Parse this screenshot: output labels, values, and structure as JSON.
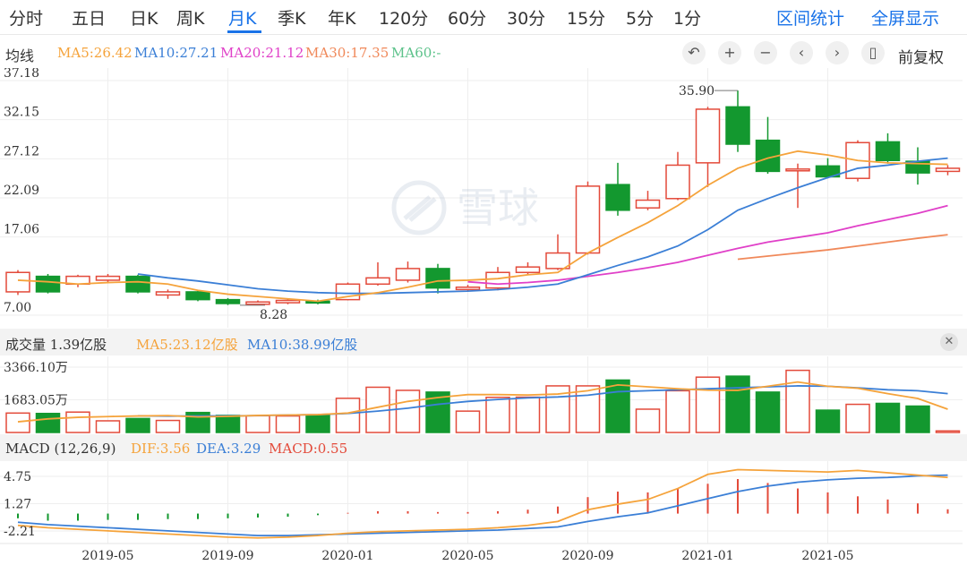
{
  "tabs": {
    "items": [
      "分时",
      "五日",
      "日K",
      "周K",
      "月K",
      "季K",
      "年K",
      "120分",
      "60分",
      "30分",
      "15分",
      "5分",
      "1分"
    ],
    "active": "月K",
    "right_items": [
      "区间统计",
      "全屏显示"
    ]
  },
  "ma_row": {
    "title": "均线",
    "items": [
      {
        "label": "MA5:26.42",
        "color": "#f5a33b"
      },
      {
        "label": "MA10:27.21",
        "color": "#3b7fd6"
      },
      {
        "label": "MA20:21.12",
        "color": "#e040c8"
      },
      {
        "label": "MA30:17.35",
        "color": "#f0895a"
      },
      {
        "label": "MA60:-",
        "color": "#5cc28a"
      }
    ],
    "controls": [
      "↶",
      "+",
      "−",
      "‹",
      "›",
      "▯"
    ],
    "restore_label": "前复权"
  },
  "volume_row": {
    "title": "成交量 1.39亿股",
    "ma5": "MA5:23.12亿股",
    "ma10": "MA10:38.99亿股"
  },
  "macd_row": {
    "title": "MACD (12,26,9)",
    "dif": "DIF:3.56",
    "dea": "DEA:3.29",
    "macd": "MACD:0.55"
  },
  "watermark": "雪球",
  "colors": {
    "up": "#e34a3a",
    "down": "#13982f",
    "ma5": "#f5a33b",
    "ma10": "#3b7fd6",
    "ma20": "#e040c8",
    "ma30": "#f0895a",
    "grid": "#eeeeee"
  },
  "chart_data": [
    {
      "type": "candlestick",
      "price_axis_labels": [
        "37.18",
        "32.15",
        "27.12",
        "22.09",
        "17.06",
        "7.00"
      ],
      "ylim": [
        7.0,
        37.18
      ],
      "high_annotation": "35.90",
      "low_annotation": "8.28",
      "x_tick_labels": [
        "2019-05",
        "2019-09",
        "2020-01",
        "2020-05",
        "2020-09",
        "2021-01",
        "2021-05"
      ],
      "candles": [
        {
          "o": 10.0,
          "c": 12.5,
          "h": 12.8,
          "l": 9.6
        },
        {
          "o": 12.0,
          "c": 10.0,
          "h": 12.3,
          "l": 9.8
        },
        {
          "o": 11.0,
          "c": 12.0,
          "h": 12.2,
          "l": 10.6
        },
        {
          "o": 11.5,
          "c": 12.0,
          "h": 12.3,
          "l": 11.2
        },
        {
          "o": 12.0,
          "c": 10.0,
          "h": 12.2,
          "l": 9.8
        },
        {
          "o": 9.6,
          "c": 10.0,
          "h": 10.3,
          "l": 9.1
        },
        {
          "o": 10.0,
          "c": 9.0,
          "h": 10.2,
          "l": 8.8
        },
        {
          "o": 9.0,
          "c": 8.5,
          "h": 9.2,
          "l": 8.3
        },
        {
          "o": 8.4,
          "c": 8.7,
          "h": 8.9,
          "l": 8.28
        },
        {
          "o": 8.6,
          "c": 8.9,
          "h": 9.1,
          "l": 8.4
        },
        {
          "o": 8.8,
          "c": 8.6,
          "h": 9.0,
          "l": 8.4
        },
        {
          "o": 9.0,
          "c": 11.0,
          "h": 11.2,
          "l": 8.9
        },
        {
          "o": 11.0,
          "c": 11.8,
          "h": 13.8,
          "l": 10.8
        },
        {
          "o": 11.5,
          "c": 13.0,
          "h": 13.9,
          "l": 11.2
        },
        {
          "o": 13.0,
          "c": 10.5,
          "h": 13.6,
          "l": 9.8
        },
        {
          "o": 10.3,
          "c": 10.6,
          "h": 10.9,
          "l": 10.0
        },
        {
          "o": 10.5,
          "c": 12.5,
          "h": 13.2,
          "l": 10.2
        },
        {
          "o": 12.5,
          "c": 13.2,
          "h": 13.8,
          "l": 12.2
        },
        {
          "o": 13.0,
          "c": 15.0,
          "h": 17.4,
          "l": 12.8
        },
        {
          "o": 15.0,
          "c": 23.6,
          "h": 24.2,
          "l": 14.8
        },
        {
          "o": 23.8,
          "c": 20.5,
          "h": 26.6,
          "l": 19.8
        },
        {
          "o": 20.8,
          "c": 21.8,
          "h": 23.0,
          "l": 20.5
        },
        {
          "o": 22.0,
          "c": 26.3,
          "h": 28.0,
          "l": 21.8
        },
        {
          "o": 26.6,
          "c": 33.5,
          "h": 33.8,
          "l": 23.5
        },
        {
          "o": 33.8,
          "c": 29.0,
          "h": 35.9,
          "l": 28.0
        },
        {
          "o": 29.5,
          "c": 25.5,
          "h": 32.5,
          "l": 25.2
        },
        {
          "o": 25.6,
          "c": 25.8,
          "h": 26.5,
          "l": 20.8
        },
        {
          "o": 26.2,
          "c": 24.8,
          "h": 27.2,
          "l": 24.6
        },
        {
          "o": 24.6,
          "c": 29.2,
          "h": 29.5,
          "l": 24.2
        },
        {
          "o": 29.3,
          "c": 26.9,
          "h": 30.4,
          "l": 26.5
        },
        {
          "o": 26.8,
          "c": 25.3,
          "h": 28.6,
          "l": 23.8
        },
        {
          "o": 25.5,
          "c": 25.9,
          "h": 26.3,
          "l": 25.0
        }
      ],
      "ma5": [
        11.5,
        11.3,
        11.0,
        11.2,
        11.3,
        11.0,
        10.2,
        9.7,
        9.4,
        9.1,
        8.8,
        9.4,
        9.9,
        10.6,
        11.4,
        11.5,
        11.7,
        12.2,
        12.5,
        15.0,
        17.0,
        18.9,
        21.1,
        23.7,
        25.9,
        27.2,
        28.1,
        27.6,
        26.9,
        26.6,
        26.5,
        26.4
      ],
      "ma10": [
        null,
        null,
        null,
        null,
        12.3,
        11.8,
        11.4,
        10.9,
        10.4,
        10.1,
        9.9,
        9.8,
        9.8,
        9.9,
        10.0,
        10.1,
        10.3,
        10.6,
        11.0,
        12.2,
        13.4,
        14.5,
        15.9,
        18.0,
        20.5,
        22.0,
        23.4,
        24.7,
        25.9,
        26.3,
        26.8,
        27.2
      ],
      "ma20": [
        null,
        null,
        null,
        null,
        null,
        null,
        null,
        null,
        null,
        null,
        null,
        null,
        null,
        null,
        null,
        11.3,
        11.0,
        11.2,
        11.5,
        12.0,
        12.5,
        13.1,
        13.8,
        14.7,
        15.6,
        16.4,
        17.0,
        17.6,
        18.5,
        19.3,
        20.1,
        21.1
      ],
      "ma30": [
        null,
        null,
        null,
        null,
        null,
        null,
        null,
        null,
        null,
        null,
        null,
        null,
        null,
        null,
        null,
        null,
        null,
        null,
        null,
        null,
        null,
        null,
        null,
        null,
        14.2,
        14.6,
        15.0,
        15.4,
        15.9,
        16.4,
        16.9,
        17.35
      ]
    },
    {
      "type": "bar",
      "title": "成交量",
      "axis_labels": [
        "3366.10万",
        "1683.05万"
      ],
      "ylim": [
        0,
        3366.1
      ],
      "values": [
        1000,
        980,
        1050,
        600,
        720,
        620,
        1030,
        880,
        860,
        850,
        880,
        1760,
        2330,
        2170,
        2080,
        1100,
        1810,
        1820,
        2400,
        2400,
        2700,
        1200,
        2150,
        2850,
        2900,
        2080,
        3200,
        1150,
        1450,
        1500,
        1360,
        80
      ],
      "ma5": [
        550,
        700,
        780,
        820,
        850,
        870,
        800,
        830,
        880,
        900,
        920,
        1000,
        1300,
        1600,
        1800,
        1950,
        1950,
        1930,
        1980,
        2150,
        2450,
        2350,
        2250,
        2180,
        2170,
        2380,
        2600,
        2380,
        2280,
        2000,
        1750,
        1200
      ],
      "ma10": [
        null,
        null,
        null,
        null,
        860,
        840,
        850,
        850,
        870,
        900,
        920,
        980,
        1100,
        1250,
        1450,
        1600,
        1700,
        1780,
        1830,
        1920,
        2100,
        2150,
        2200,
        2250,
        2300,
        2350,
        2400,
        2380,
        2300,
        2200,
        2150,
        2000
      ]
    },
    {
      "type": "bar",
      "title": "MACD (12,26,9)",
      "axis_labels": [
        "4.75",
        "1.27",
        "-2.21"
      ],
      "ylim": [
        -2.9,
        6.0
      ],
      "macd": [
        -0.6,
        -0.9,
        -0.9,
        -0.8,
        -0.8,
        -0.7,
        -0.7,
        -0.6,
        -0.5,
        -0.4,
        -0.2,
        0.1,
        0.3,
        0.3,
        0.2,
        0.2,
        0.3,
        0.5,
        0.9,
        2.1,
        2.8,
        2.7,
        3.2,
        3.8,
        4.4,
        3.9,
        3.2,
        2.7,
        2.2,
        1.8,
        1.3,
        0.55
      ],
      "dif": [
        -1.5,
        -1.8,
        -2.0,
        -2.2,
        -2.4,
        -2.6,
        -2.8,
        -3.0,
        -3.1,
        -3.0,
        -2.8,
        -2.5,
        -2.3,
        -2.2,
        -2.1,
        -2.0,
        -1.8,
        -1.5,
        -1.0,
        0.5,
        1.2,
        1.8,
        3.2,
        5.0,
        5.6,
        5.5,
        5.4,
        5.3,
        5.5,
        5.2,
        4.9,
        4.6
      ],
      "dea": [
        -1.1,
        -1.4,
        -1.6,
        -1.8,
        -2.0,
        -2.2,
        -2.4,
        -2.6,
        -2.8,
        -2.8,
        -2.7,
        -2.6,
        -2.5,
        -2.4,
        -2.3,
        -2.2,
        -2.1,
        -1.9,
        -1.7,
        -1.0,
        -0.4,
        0.1,
        1.0,
        1.9,
        2.8,
        3.5,
        4.0,
        4.3,
        4.5,
        4.6,
        4.8,
        4.9
      ]
    }
  ]
}
